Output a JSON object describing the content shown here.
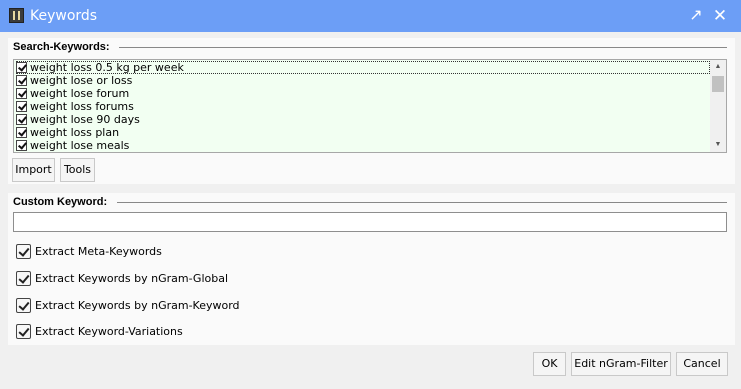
{
  "window": {
    "title": "Keywords",
    "maximize_icon": "maximize-icon",
    "close_icon": "close-icon"
  },
  "search_keywords": {
    "heading": "Search-Keywords:",
    "items": [
      {
        "label": "weight loss 0.5 kg per week",
        "checked": true
      },
      {
        "label": "weight lose or loss",
        "checked": true
      },
      {
        "label": "weight lose forum",
        "checked": true
      },
      {
        "label": "weight loss forums",
        "checked": true
      },
      {
        "label": "weight lose 90 days",
        "checked": true
      },
      {
        "label": "weight loss plan",
        "checked": true
      },
      {
        "label": "weight lose meals",
        "checked": true
      }
    ],
    "import_label": "Import",
    "tools_label": "Tools",
    "list_background": "#f2fff2"
  },
  "custom_keyword": {
    "heading": "Custom Keyword:",
    "value": "",
    "placeholder": ""
  },
  "options": [
    {
      "label": "Extract Meta-Keywords",
      "checked": true
    },
    {
      "label": "Extract Keywords by nGram-Global",
      "checked": true
    },
    {
      "label": "Extract Keywords by nGram-Keyword",
      "checked": true
    },
    {
      "label": "Extract Keyword-Variations",
      "checked": true
    }
  ],
  "footer": {
    "ok_label": "OK",
    "edit_filter_label": "Edit nGram-Filter",
    "cancel_label": "Cancel"
  },
  "colors": {
    "titlebar": "#6c9ef6",
    "panel": "#fafafa",
    "window": "#f0f0f0"
  }
}
